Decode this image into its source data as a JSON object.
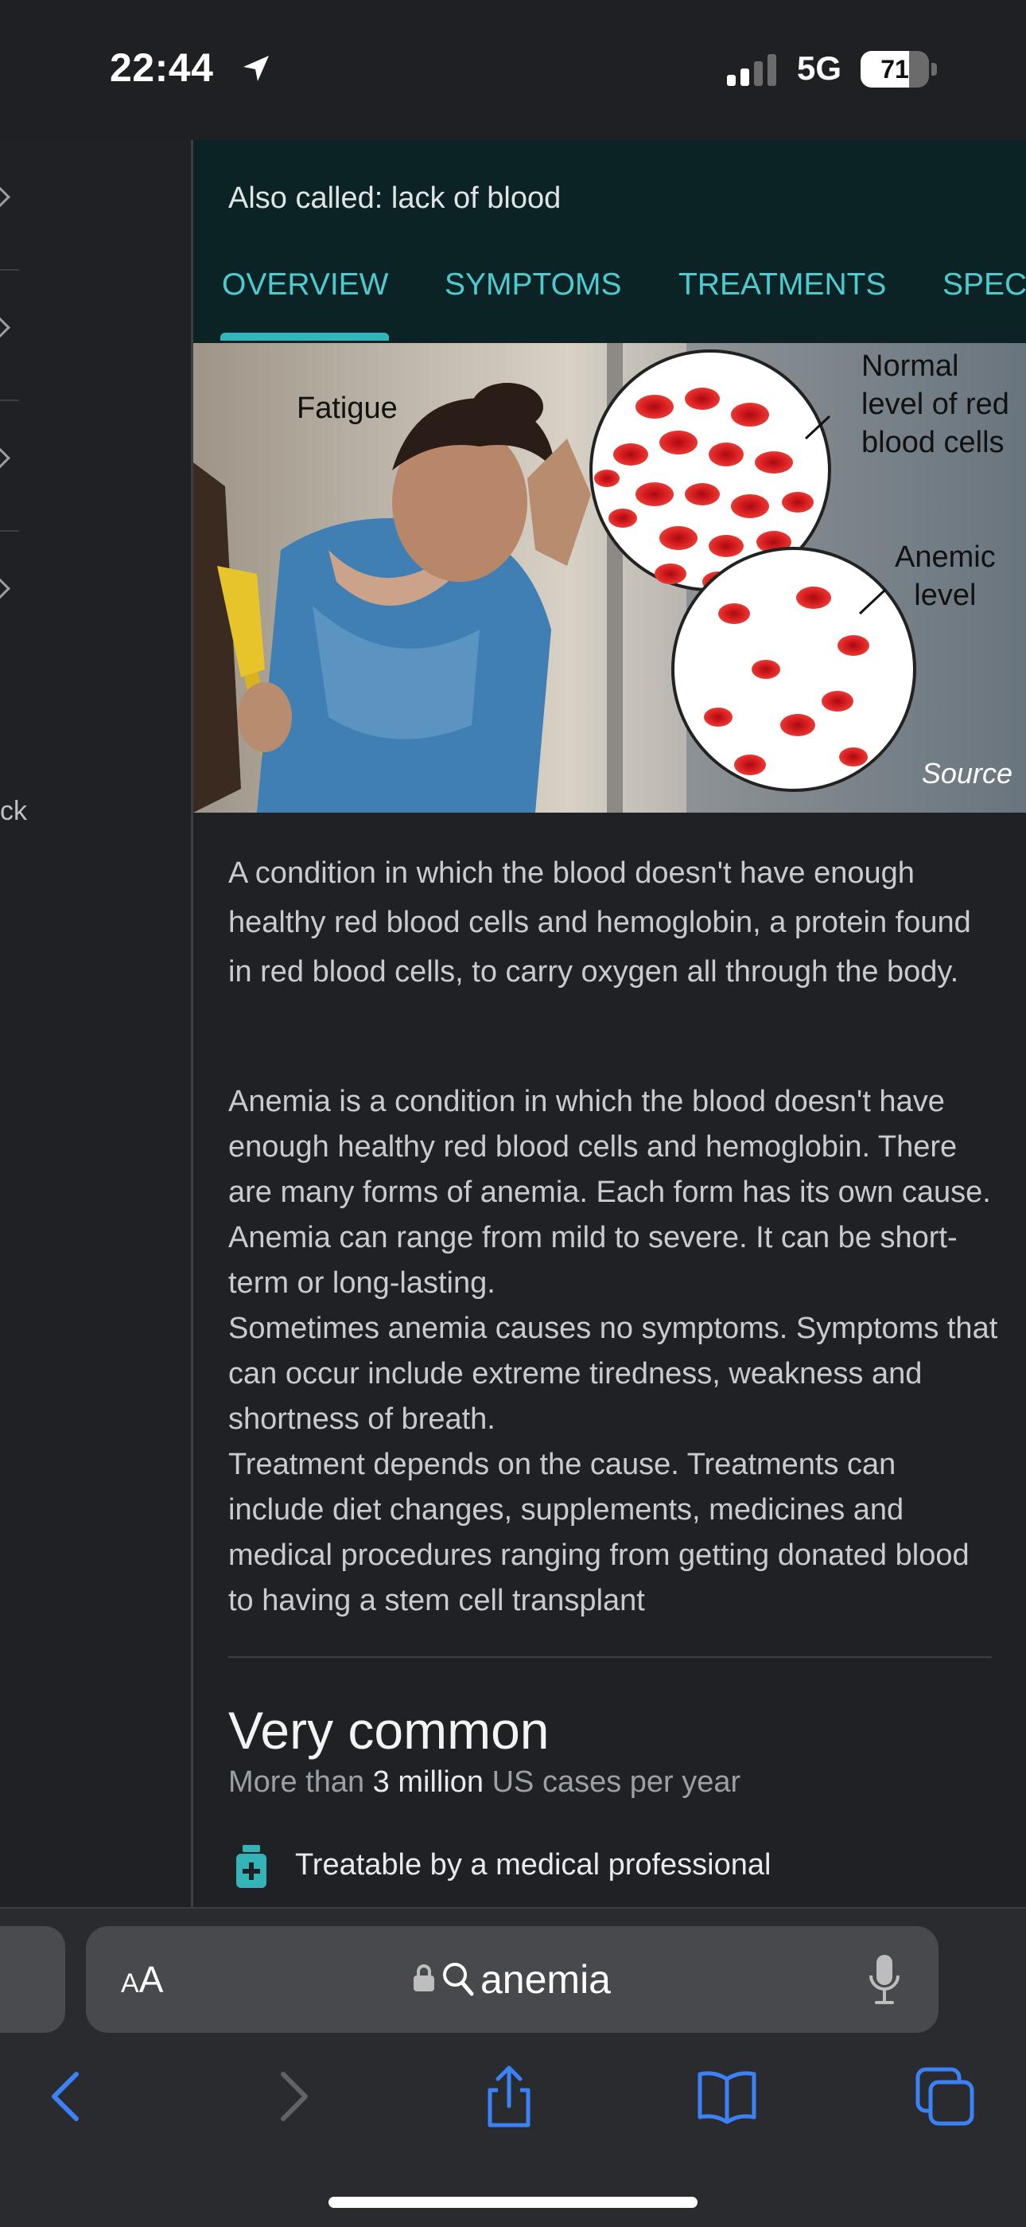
{
  "status_bar": {
    "time": "22:44",
    "network": "5G",
    "battery_level": "71",
    "battery_fraction": 0.71
  },
  "sidebar": {
    "partial_text": "ck"
  },
  "condition": {
    "also_called": "Also called: lack of blood",
    "tabs": [
      {
        "label": "OVERVIEW",
        "active": true
      },
      {
        "label": "SYMPTOMS",
        "active": false
      },
      {
        "label": "TREATMENTS",
        "active": false
      },
      {
        "label": "SPEC",
        "active": false
      }
    ],
    "image": {
      "label_fatigue": "Fatigue",
      "label_normal": "Normal\nlevel of red\nblood cells",
      "label_anemic": "Anemic\nlevel",
      "source": "Source"
    },
    "description": "A condition in which the blood doesn't have enough healthy red blood cells and hemoglobin, a protein found in red blood cells, to carry oxygen all through the body.",
    "long_description": [
      "Anemia is a condition in which the blood doesn't have enough healthy red blood cells and hemoglobin. There are many forms of anemia. Each form has its own cause. Anemia can range from mild to severe. It can be short-term or long-lasting.",
      "Sometimes anemia causes no symptoms. Symptoms that can occur include extreme tiredness, weakness and shortness of breath.",
      "Treatment depends on the cause. Treatments can include diet changes, supplements, medicines and medical procedures ranging from getting donated blood to having a stem cell transplant"
    ],
    "frequency": {
      "title": "Very common",
      "prefix": "More than ",
      "count": "3 million",
      "suffix": " US cases per year"
    },
    "treatable": "Treatable by a medical professional"
  },
  "toolbar": {
    "text_size_small": "A",
    "text_size_big": "A",
    "url": "anemia"
  },
  "colors": {
    "accent": "#4ccbd0",
    "header_bg": "#0b2325",
    "page_bg": "#202124",
    "link_blue": "#3b82f6"
  },
  "icons": [
    "location-arrow-icon",
    "signal-icon",
    "battery-icon",
    "lock-icon",
    "search-icon",
    "microphone-icon",
    "back-icon",
    "forward-icon",
    "share-icon",
    "bookmarks-icon",
    "tabs-icon",
    "medicine-icon"
  ]
}
